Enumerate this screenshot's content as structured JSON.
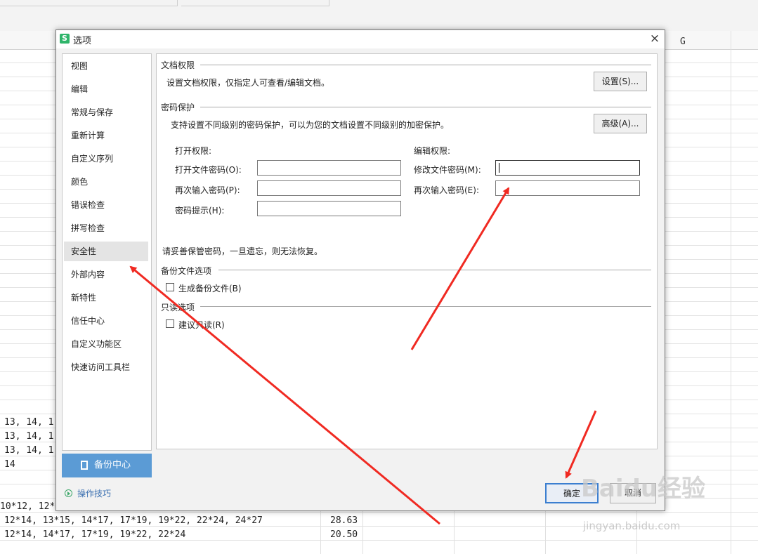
{
  "dialog": {
    "title": "选项",
    "app_icon_letter": "S",
    "close_glyph": "×"
  },
  "sidebar": {
    "items": [
      {
        "label": "视图"
      },
      {
        "label": "编辑"
      },
      {
        "label": "常规与保存"
      },
      {
        "label": "重新计算"
      },
      {
        "label": "自定义序列"
      },
      {
        "label": "颜色"
      },
      {
        "label": "错误检查"
      },
      {
        "label": "拼写检查"
      },
      {
        "label": "安全性",
        "active": true
      },
      {
        "label": "外部内容"
      },
      {
        "label": "新特性"
      },
      {
        "label": "信任中心"
      },
      {
        "label": "自定义功能区"
      },
      {
        "label": "快速访问工具栏"
      }
    ],
    "backup_button": "备份中心",
    "tips_link": "操作技巧"
  },
  "security": {
    "doc_permission": {
      "section": "文档权限",
      "description": "设置文档权限，仅指定人可查看/编辑文档。",
      "button": "设置(S)..."
    },
    "password": {
      "section": "密码保护",
      "description": "支持设置不同级别的密码保护，可以为您的文档设置不同级别的加密保护。",
      "button": "高级(A)...",
      "open_header": "打开权限:",
      "edit_header": "编辑权限:",
      "open_password_label": "打开文件密码(O):",
      "open_reenter_label": "再次输入密码(P):",
      "hint_label": "密码提示(H):",
      "modify_password_label": "修改文件密码(M):",
      "modify_reenter_label": "再次输入密码(E):",
      "warning": "请妥善保管密码，一旦遗忘，则无法恢复。"
    },
    "backup": {
      "section": "备份文件选项",
      "checkbox_label": "生成备份文件(B)",
      "checked": false
    },
    "readonly": {
      "section": "只读选项",
      "checkbox_label": "建议只读(R)",
      "checked": false
    }
  },
  "footer": {
    "ok": "确定",
    "cancel": "取消"
  },
  "sheet": {
    "column_g": "G",
    "rows": [
      {
        "text": "13, 14, 1"
      },
      {
        "text": "13, 14, 1"
      },
      {
        "text": "13, 14, 1"
      },
      {
        "text": "14"
      },
      {
        "text": "10*12, 12*"
      },
      {
        "text": "12*14, 13*15, 14*17, 17*19, 19*22, 22*24, 24*27",
        "value": "28.63"
      },
      {
        "text": "12*14, 14*17, 17*19, 19*22, 22*24",
        "value": "20.50"
      }
    ]
  },
  "watermark": {
    "brand": "Baidu经验",
    "url": "jingyan.baidu.com"
  },
  "annotation_color": "#f02a22"
}
